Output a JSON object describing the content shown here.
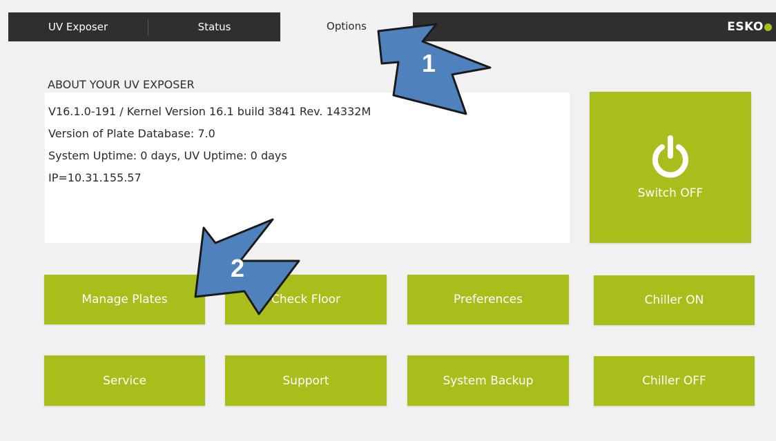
{
  "tabs": [
    {
      "label": "UV Exposer",
      "active": false
    },
    {
      "label": "Status",
      "active": false
    },
    {
      "label": "Options",
      "active": true
    }
  ],
  "brand": {
    "name": "ESKO",
    "accent": "#a9bd1b"
  },
  "about": {
    "title": "ABOUT YOUR UV EXPOSER",
    "lines": [
      "V16.1.0-191 / Kernel Version 16.1 build 3841 Rev. 14332M",
      "Version of Plate Database: 7.0",
      "System Uptime: 0 days, UV Uptime: 0 days",
      "IP=10.31.155.57"
    ]
  },
  "power": {
    "label": "Switch OFF",
    "icon": "power-icon"
  },
  "buttons": {
    "manage_plates": "Manage Plates",
    "check_floor": "Check Floor",
    "preferences": "Preferences",
    "chiller_on": "Chiller ON",
    "service": "Service",
    "support": "Support",
    "system_backup": "System Backup",
    "chiller_off": "Chiller OFF"
  },
  "callouts": [
    {
      "number": "1",
      "color": "#4f81bd"
    },
    {
      "number": "2",
      "color": "#4f81bd"
    }
  ]
}
